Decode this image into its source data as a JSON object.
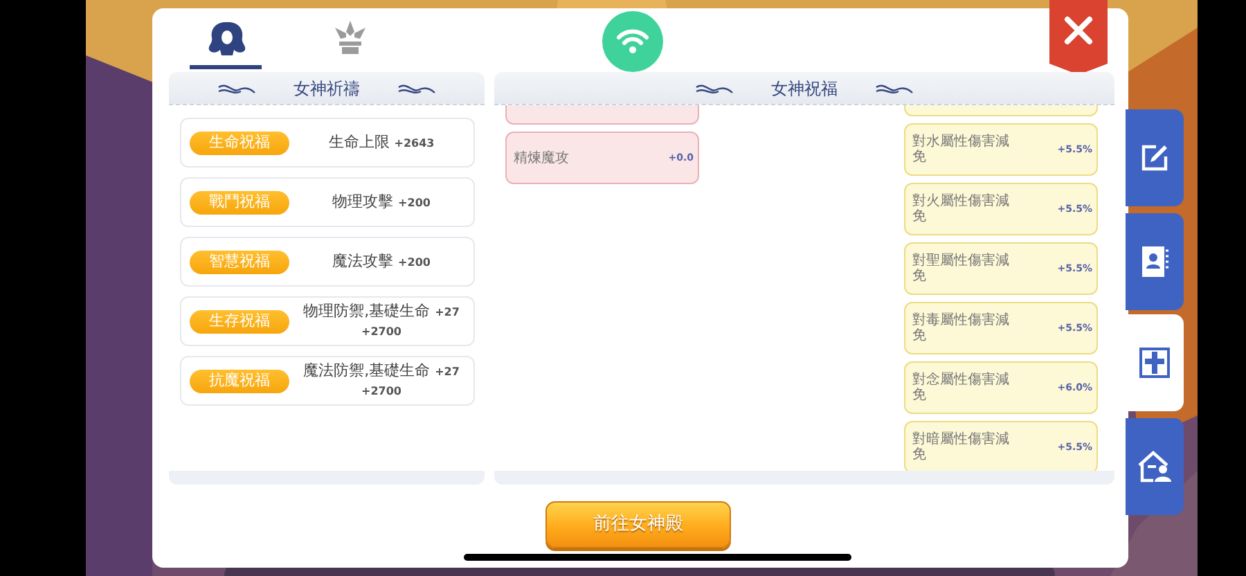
{
  "tabs": [
    {
      "kind": "goddess",
      "selected": true
    },
    {
      "kind": "emblem",
      "selected": false
    }
  ],
  "prayer": {
    "title": "女神祈禱",
    "items": [
      {
        "tag": "生命祝福",
        "stat": "生命上限",
        "values": [
          "+2643"
        ]
      },
      {
        "tag": "戰鬥祝福",
        "stat": "物理攻擊",
        "values": [
          "+200"
        ]
      },
      {
        "tag": "智慧祝福",
        "stat": "魔法攻擊",
        "values": [
          "+200"
        ]
      },
      {
        "tag": "生存祝福",
        "stat": "物理防禦,基礎生命",
        "values": [
          "+27",
          "+2700"
        ]
      },
      {
        "tag": "抗魔祝福",
        "stat": "魔法防禦,基礎生命",
        "values": [
          "+27",
          "+2700"
        ]
      }
    ]
  },
  "blessing": {
    "title": "女神祝福",
    "left": [
      {
        "name": "精煉魔攻",
        "value": "+0.0"
      }
    ],
    "right": [
      {
        "name": "對水屬性傷害減免",
        "value": "+5.5%"
      },
      {
        "name": "對火屬性傷害減免",
        "value": "+5.5%"
      },
      {
        "name": "對聖屬性傷害減免",
        "value": "+5.5%"
      },
      {
        "name": "對毒屬性傷害減免",
        "value": "+5.5%"
      },
      {
        "name": "對念屬性傷害減免",
        "value": "+6.0%"
      },
      {
        "name": "對暗屬性傷害減免",
        "value": "+5.5%"
      }
    ]
  },
  "button": "前往女神殿",
  "side_tabs": [
    {
      "kind": "edit",
      "selected": false
    },
    {
      "kind": "contacts",
      "selected": false
    },
    {
      "kind": "cross",
      "selected": true
    },
    {
      "kind": "house",
      "selected": false
    }
  ]
}
